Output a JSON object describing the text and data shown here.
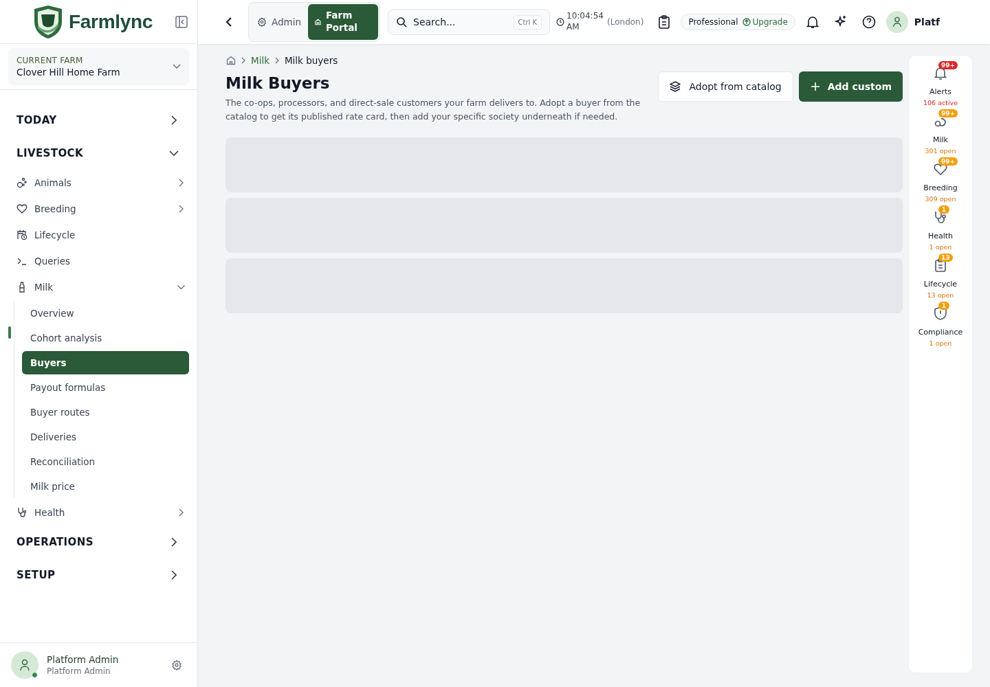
{
  "brand": "Farmlync",
  "top_tabs": [
    {
      "label": "Admin",
      "selected": false
    },
    {
      "label": "Farm Portal",
      "selected": true
    }
  ],
  "search": {
    "placeholder": "Search...",
    "shortcut": "Ctrl K"
  },
  "clock": {
    "time": "10:04:54 AM",
    "zone": "(London)"
  },
  "plan": {
    "name": "Professional",
    "action": "Upgrade"
  },
  "user_name": "Platf",
  "farm": {
    "label": "CURRENT FARM",
    "name": "Clover Hill Home Farm"
  },
  "nav": [
    {
      "label": "TODAY",
      "expanded": false
    },
    {
      "label": "LIVESTOCK",
      "expanded": true,
      "items": [
        {
          "label": "Animals",
          "expanded": false
        },
        {
          "label": "Breeding",
          "expanded": false
        },
        {
          "label": "Lifecycle"
        },
        {
          "label": "Queries"
        },
        {
          "label": "Milk",
          "expanded": true,
          "children": [
            {
              "label": "Overview",
              "selected": false
            },
            {
              "label": "Cohort analysis",
              "selected": false
            },
            {
              "label": "Buyers",
              "selected": true
            },
            {
              "label": "Payout formulas",
              "selected": false
            },
            {
              "label": "Buyer routes",
              "selected": false
            },
            {
              "label": "Deliveries",
              "selected": false
            },
            {
              "label": "Reconciliation",
              "selected": false
            },
            {
              "label": "Milk price",
              "selected": false
            }
          ]
        },
        {
          "label": "Health",
          "expanded": false
        }
      ]
    },
    {
      "label": "OPERATIONS",
      "expanded": false
    },
    {
      "label": "SETUP",
      "expanded": false
    }
  ],
  "profile": {
    "name": "Platform Admin",
    "role": "Platform Admin",
    "online": true
  },
  "breadcrumb": [
    "Milk",
    "Milk buyers"
  ],
  "page": {
    "title": "Milk Buyers",
    "description": "The co-ops, processors, and direct-sale customers your farm delivers to. Adopt a buyer from the catalog to get its published rate card, then add your specific society underneath if needed."
  },
  "actions": [
    {
      "label": "Adopt from catalog",
      "kind": "secondary"
    },
    {
      "label": "Add custom",
      "kind": "primary"
    }
  ],
  "loading_rows": [
    {
      "kind": "skeleton"
    },
    {
      "kind": "skeleton"
    },
    {
      "kind": "skeleton"
    }
  ],
  "rail": [
    {
      "label": "Alerts",
      "badge": "99+",
      "status": "106 active",
      "color": "#dc2626"
    },
    {
      "label": "Milk",
      "badge": "99+",
      "status": "301 open",
      "color": "#f59e0b"
    },
    {
      "label": "Breeding",
      "badge": "99+",
      "status": "309 open",
      "color": "#f59e0b"
    },
    {
      "label": "Health",
      "badge": "1",
      "status": "1 open",
      "color": "#f59e0b"
    },
    {
      "label": "Lifecycle",
      "badge": "13",
      "status": "13 open",
      "color": "#f59e0b"
    },
    {
      "label": "Compliance",
      "badge": "1",
      "status": "1 open",
      "color": "#f59e0b"
    }
  ]
}
